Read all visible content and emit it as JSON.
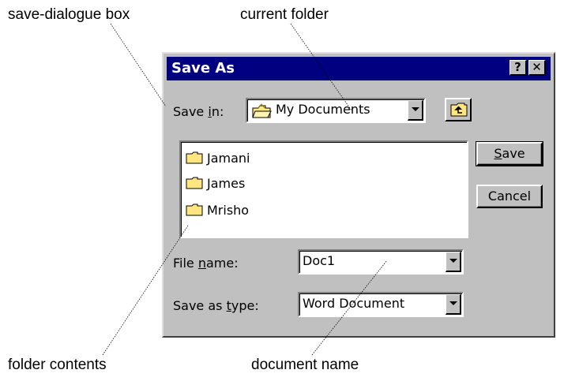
{
  "callouts": {
    "save_dialogue_box": "save-dialogue box",
    "current_folder": "current folder",
    "folder_contents": "folder contents",
    "document_name": "document name"
  },
  "dialog": {
    "title": "Save As",
    "help_button": "?",
    "close_button": "✕",
    "save_in_label_pre": "Save ",
    "save_in_label_key": "i",
    "save_in_label_post": "n:",
    "save_in_value": "My Documents",
    "folders": [
      {
        "label": "Jamani"
      },
      {
        "label": "James"
      },
      {
        "label": "Mrisho"
      }
    ],
    "file_name_label_pre": "File ",
    "file_name_label_key": "n",
    "file_name_label_post": "ame:",
    "file_name_value": "Doc1",
    "save_type_label_pre": "Save as ",
    "save_type_label_key": "t",
    "save_type_label_post": "ype:",
    "save_type_value": "Word Document",
    "save_button_key": "S",
    "save_button_rest": "ave",
    "cancel_button": "Cancel"
  },
  "colors": {
    "titlebar": "#000080",
    "face": "#c0c0c0",
    "folder": "#ffe680"
  },
  "icons": {
    "folder": "folder-icon",
    "open_folder": "open-folder-icon",
    "up_one_level": "up-folder-icon",
    "dropdown": "chevron-down-icon"
  }
}
